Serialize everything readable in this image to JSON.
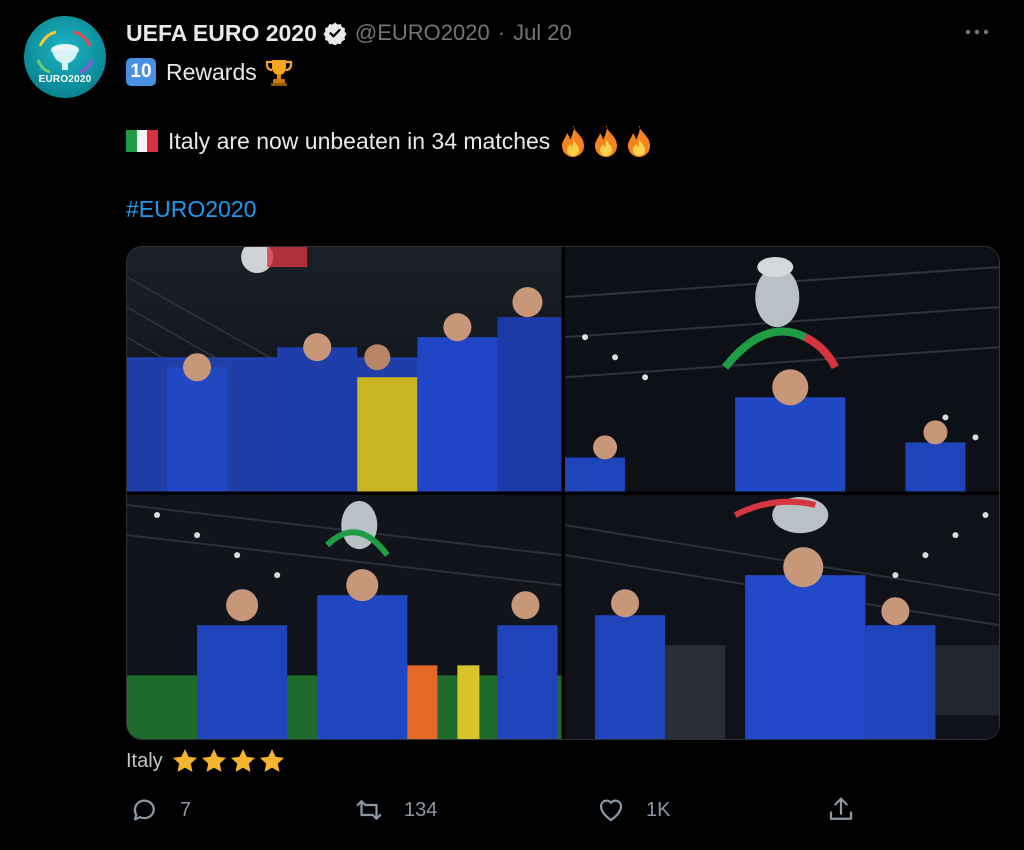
{
  "tweet": {
    "author": {
      "display_name": "UEFA EURO 2020",
      "handle": "@EURO2020",
      "avatar_text": "EURO2020",
      "verified": true
    },
    "separator": "·",
    "date": "Jul 20",
    "line1": {
      "badge": "10",
      "text": "Rewards",
      "emoji": "trophy-icon"
    },
    "line2": {
      "emoji_flag": "italy-flag-icon",
      "text": "Italy are now unbeaten in 34 matches",
      "emoji_count": 3
    },
    "hashtag": "#EURO2020",
    "caption": {
      "text": "Italy",
      "stars": 4
    },
    "actions": {
      "replies": "7",
      "retweets": "134",
      "likes": "1K"
    }
  },
  "colors": {
    "background": "#000000",
    "text": "#e7e9ea",
    "muted": "#71767b",
    "link": "#1d9bf0",
    "italy_blue": "#1d4ed8",
    "star": "#f5b32e"
  }
}
